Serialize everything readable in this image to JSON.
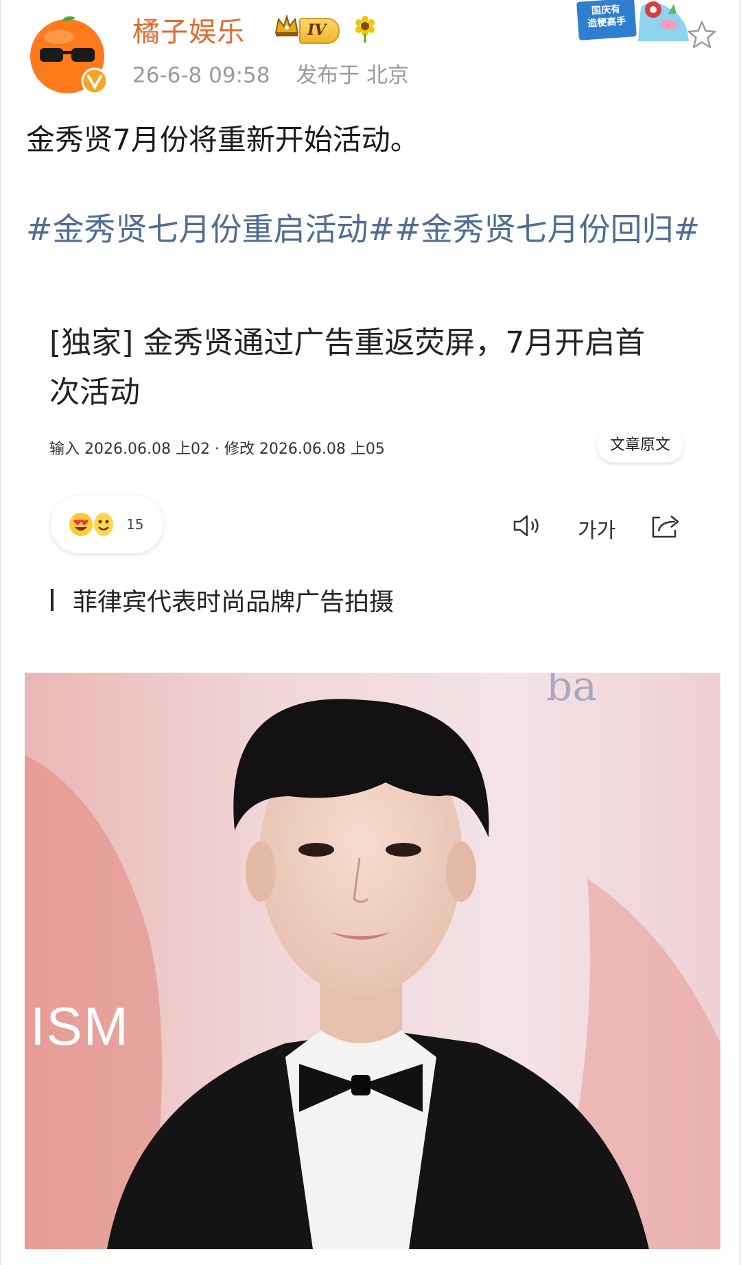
{
  "header": {
    "username": "橘子娱乐",
    "level": "IV",
    "timestamp": "26-6-8 09:58",
    "location_label": "发布于 北京",
    "campaign_text_line1": "国庆有",
    "campaign_text_line2": "造梗高手"
  },
  "post": {
    "text": "金秀贤7月份将重新开始活动。",
    "hashtags": "#金秀贤七月份重启活动##金秀贤七月份回归#"
  },
  "article": {
    "title": "[独家] 金秀贤通过广告重返荧屏，7月开启首次活动",
    "meta": "输入 2026.06.08 上02 · 修改 2026.06.08 上05",
    "original_button": "文章原文",
    "reaction_count": "15",
    "font_size_label": "가가",
    "subheading": "菲律宾代表时尚品牌广告拍摄"
  },
  "photo": {
    "watermark": "ISM",
    "background_text": "ba"
  },
  "colors": {
    "username": "#e46a2f",
    "hashtag": "#4f6c94",
    "meta": "#9a9a9a",
    "verified": "#f5a623"
  }
}
